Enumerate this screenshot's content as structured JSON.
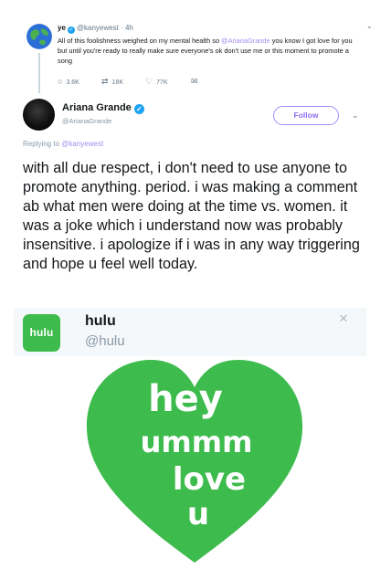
{
  "kanye_tweet": {
    "name": "ye",
    "handle": "@kanyewest",
    "time": "· 4h",
    "text_before": "All of this foolishness weighed on my mental health so ",
    "mention": "@ArianaGrande",
    "text_after": " you know I got love for you but until you're ready to really make sure everyone's ok don't use me or this moment to promote a song",
    "actions": {
      "replies": "3.6K",
      "retweets": "18K",
      "likes": "77K"
    },
    "icons": [
      "reply-icon",
      "retweet-icon",
      "heart-icon",
      "message-icon",
      "chevron-down-icon",
      "earth-avatar"
    ]
  },
  "ariana_tweet": {
    "name": "Ariana Grande",
    "handle": "@ArianaGrande",
    "follow_label": "Follow",
    "replying_to_label": "Replying to ",
    "replying_to_handle": "@kanyewest",
    "text": "with all due respect, i don't need to use anyone to promote anything. period. i was making a comment ab what men were doing at the time vs. women. it was a joke which i understand now was probably insensitive. i apologize if i was in any way triggering and hope u feel well today."
  },
  "hulu_card": {
    "logo_text": "hulu",
    "name": "hulu",
    "handle": "@hulu",
    "close_symbol": "×"
  },
  "heart_image": {
    "line1": "hey",
    "line2": "ummm",
    "line3": "love",
    "line4": "u",
    "color": "#3dbb4c"
  },
  "colors": {
    "verified": "#1da1f2",
    "mention": "#a68cf0",
    "follow": "#8b6cf0",
    "hulu_green": "#3dbb4c",
    "muted": "#657786"
  }
}
